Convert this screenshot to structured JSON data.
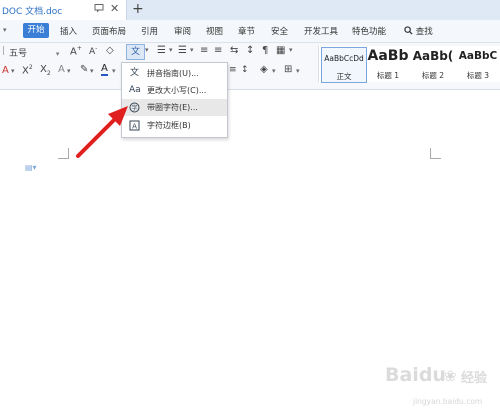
{
  "window": {
    "doc_title": "DOC 文档.doc",
    "new_tab_symbol": "+",
    "close_symbol": "✕"
  },
  "menu": {
    "items": [
      "开始",
      "插入",
      "页面布局",
      "引用",
      "审阅",
      "视图",
      "章节",
      "安全",
      "开发工具",
      "特色功能"
    ],
    "search_label": "查找"
  },
  "toolbar": {
    "font_size": "五号"
  },
  "styles": [
    {
      "preview": "AaBbCcDd",
      "label": "正文"
    },
    {
      "preview": "AaBb",
      "label": "标题 1"
    },
    {
      "preview": "AaBb(",
      "label": "标题 2"
    },
    {
      "preview": "AaBbC",
      "label": "标题 3"
    }
  ],
  "dropdown": {
    "items": [
      {
        "label": "拼音指南(U)..."
      },
      {
        "label": "更改大小写(C)..."
      },
      {
        "label": "带圈字符(E)..."
      },
      {
        "label": "字符边框(B)"
      }
    ]
  },
  "colors": {
    "accent": "#3a7fd5",
    "arrow": "#e0201e"
  },
  "watermark": {
    "brand": "Baidu",
    "sub": "经验",
    "url": "jingyan.baidu.com"
  }
}
